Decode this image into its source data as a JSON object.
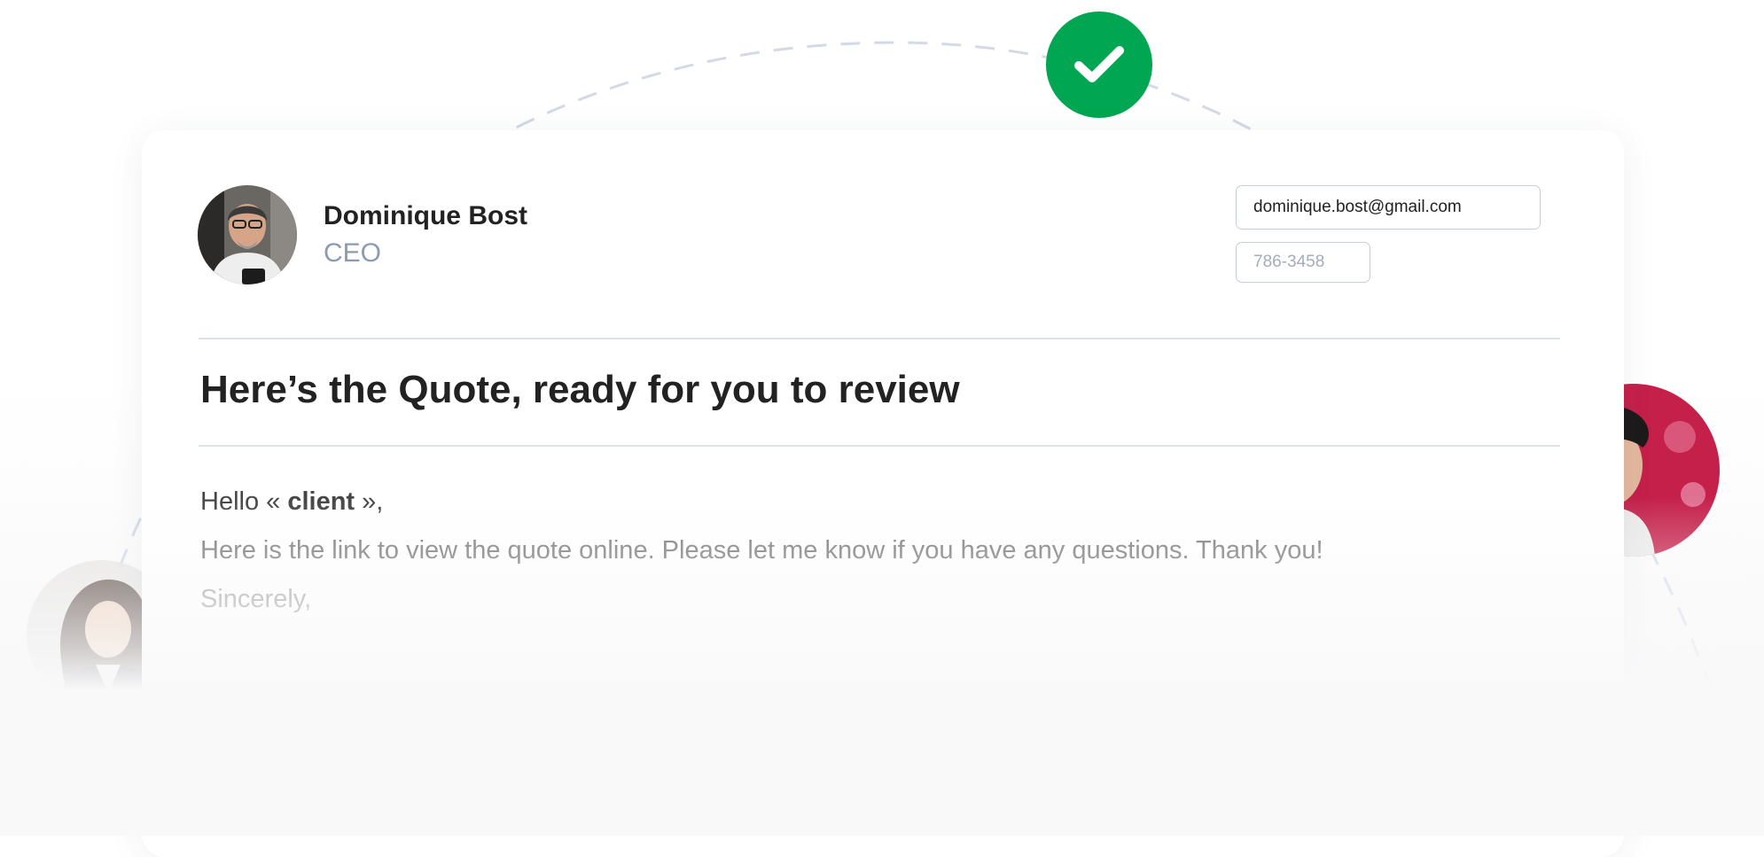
{
  "status": {
    "icon": "checkmark-icon",
    "color": "#00a651"
  },
  "sender": {
    "name": "Dominique Bost",
    "role": "CEO",
    "avatar": "man-portrait-avatar"
  },
  "contact": {
    "email": "dominique.bost@gmail.com",
    "phone": "786-3458"
  },
  "email": {
    "title": "Here’s the Quote, ready for you to review",
    "greeting_prefix": "Hello « ",
    "greeting_name": "client",
    "greeting_suffix": " »,",
    "body": "Here is the link to view the quote online. Please let me know if you have any questions. Thank you!",
    "sign_off": "Sincerely,"
  },
  "side_avatars": {
    "left": "woman-portrait-avatar",
    "right": "woman-portrait-avatar"
  },
  "colors": {
    "accent": "#00a651",
    "role_text": "#8a9bb2",
    "right_avatar_bg": "#c4204a",
    "button_bg": "#eef1fa"
  }
}
